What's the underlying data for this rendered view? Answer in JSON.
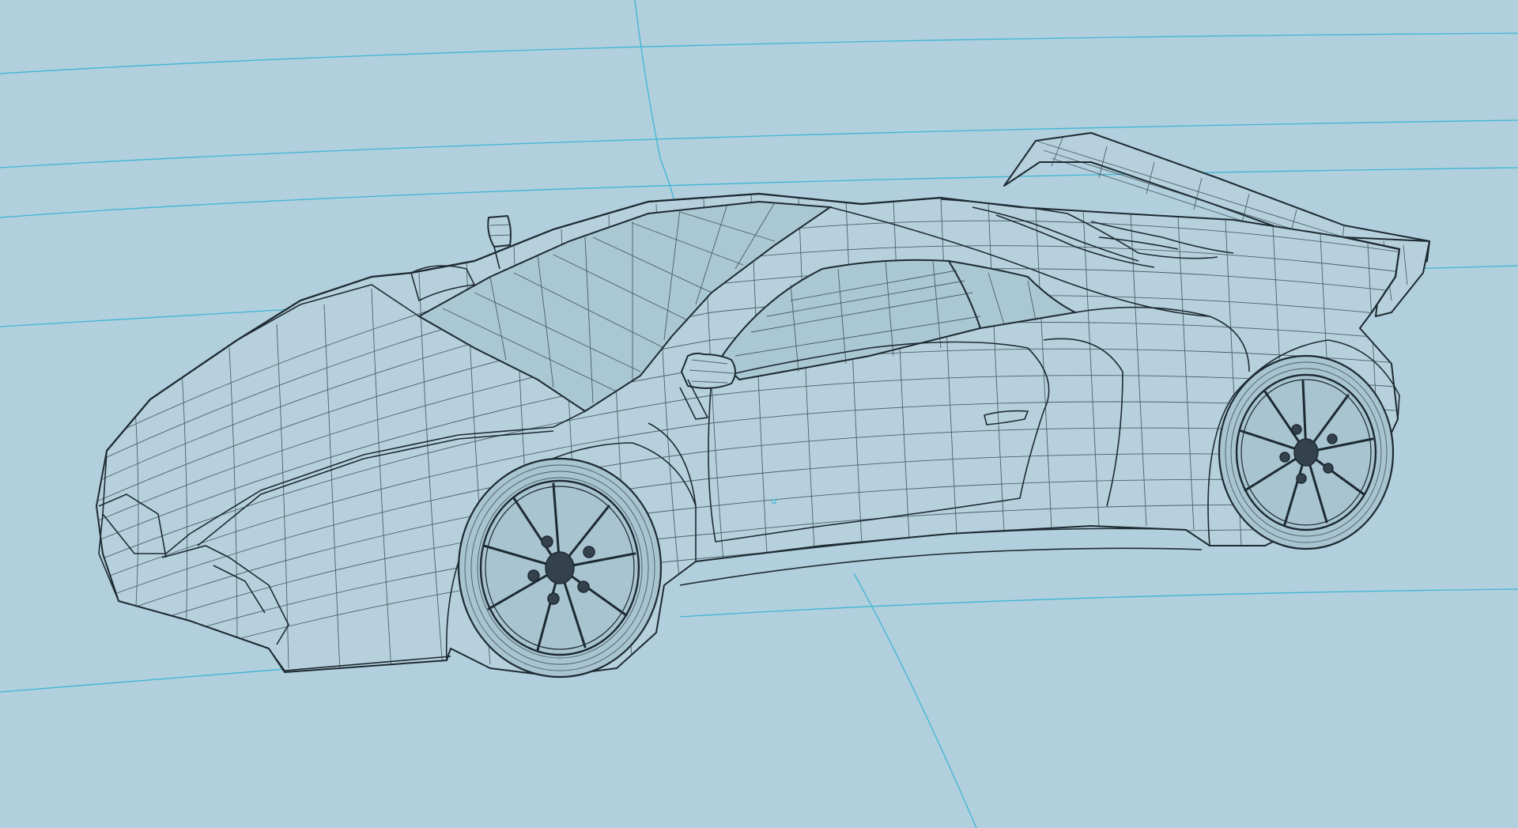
{
  "viewport": {
    "background_color": "#b1cfdc",
    "grid_color": "#3fb6d6",
    "wire_color": "#1e2a33"
  },
  "model": {
    "type": "sports-car",
    "display_mode": "wireframe"
  }
}
